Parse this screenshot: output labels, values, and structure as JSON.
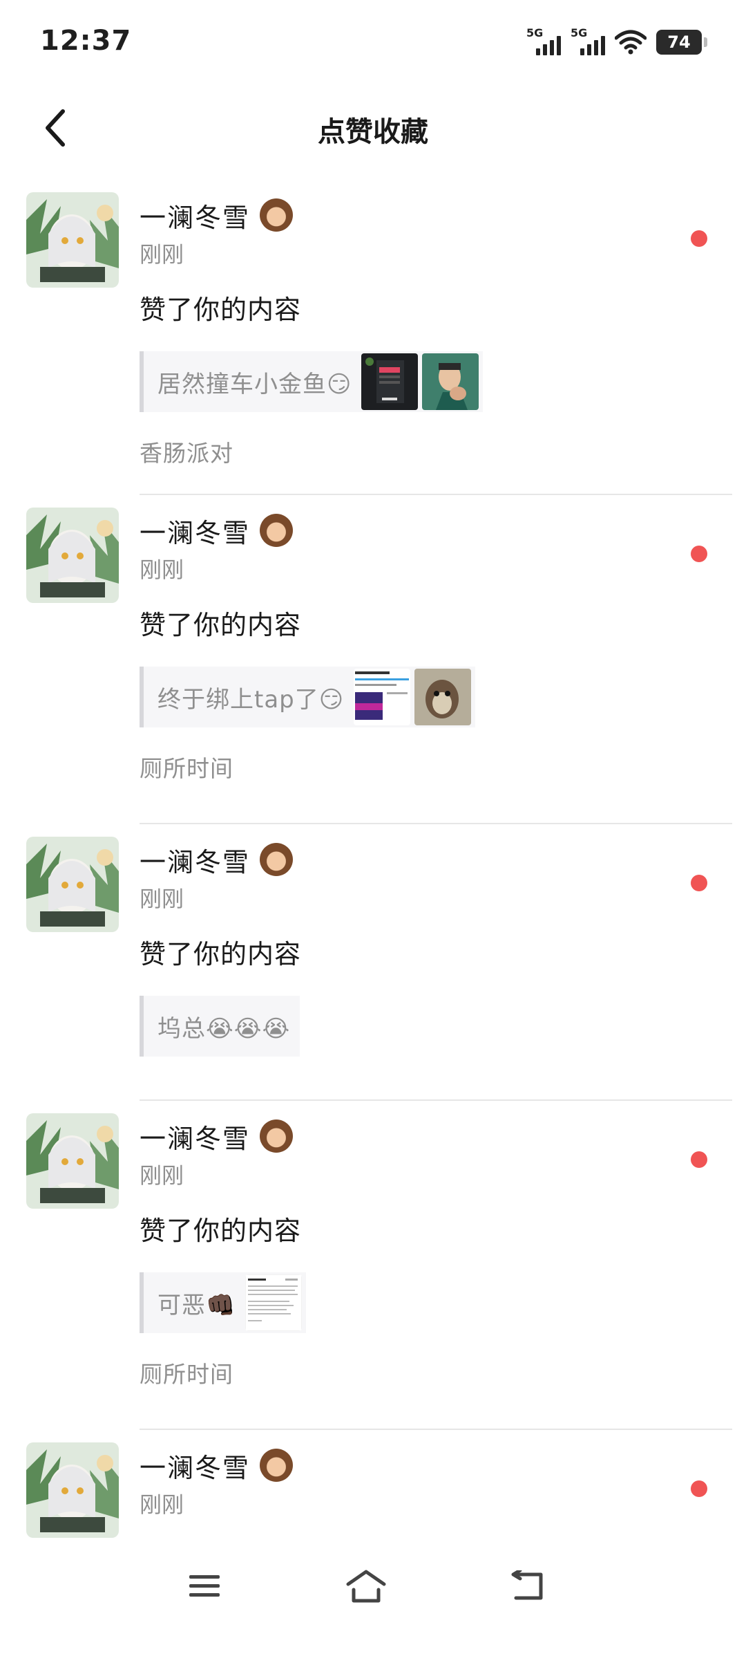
{
  "status_bar": {
    "time": "12:37",
    "sim1_label": "5G",
    "sim2_label": "5G",
    "battery_level": "74",
    "icons": [
      "signal-icon",
      "signal-icon",
      "wifi-icon",
      "battery-icon"
    ]
  },
  "header": {
    "title": "点赞收藏",
    "back_icon": "chevron-left-icon"
  },
  "colors": {
    "unread_dot": "#f05454",
    "secondary_text": "#8f8f8f",
    "quote_bg": "#f6f6f8"
  },
  "notifications": [
    {
      "user": "一澜冬雪",
      "time": "刚刚",
      "action": "赞了你的内容",
      "quote": "居然撞车小金鱼😏",
      "topic": "香肠派对",
      "unread": true
    },
    {
      "user": "一澜冬雪",
      "time": "刚刚",
      "action": "赞了你的内容",
      "quote": "终于绑上tap了😏",
      "topic": "厕所时间",
      "unread": true
    },
    {
      "user": "一澜冬雪",
      "time": "刚刚",
      "action": "赞了你的内容",
      "quote": "坞总😭😭😭",
      "topic": "",
      "unread": true
    },
    {
      "user": "一澜冬雪",
      "time": "刚刚",
      "action": "赞了你的内容",
      "quote": "可恶👊🏿",
      "topic": "厕所时间",
      "unread": true
    },
    {
      "user": "一澜冬雪",
      "time": "刚刚",
      "action": "",
      "quote": "",
      "topic": "",
      "unread": true
    }
  ],
  "bottom_nav": {
    "icons": [
      "menu-icon",
      "home-icon",
      "back-icon"
    ]
  }
}
